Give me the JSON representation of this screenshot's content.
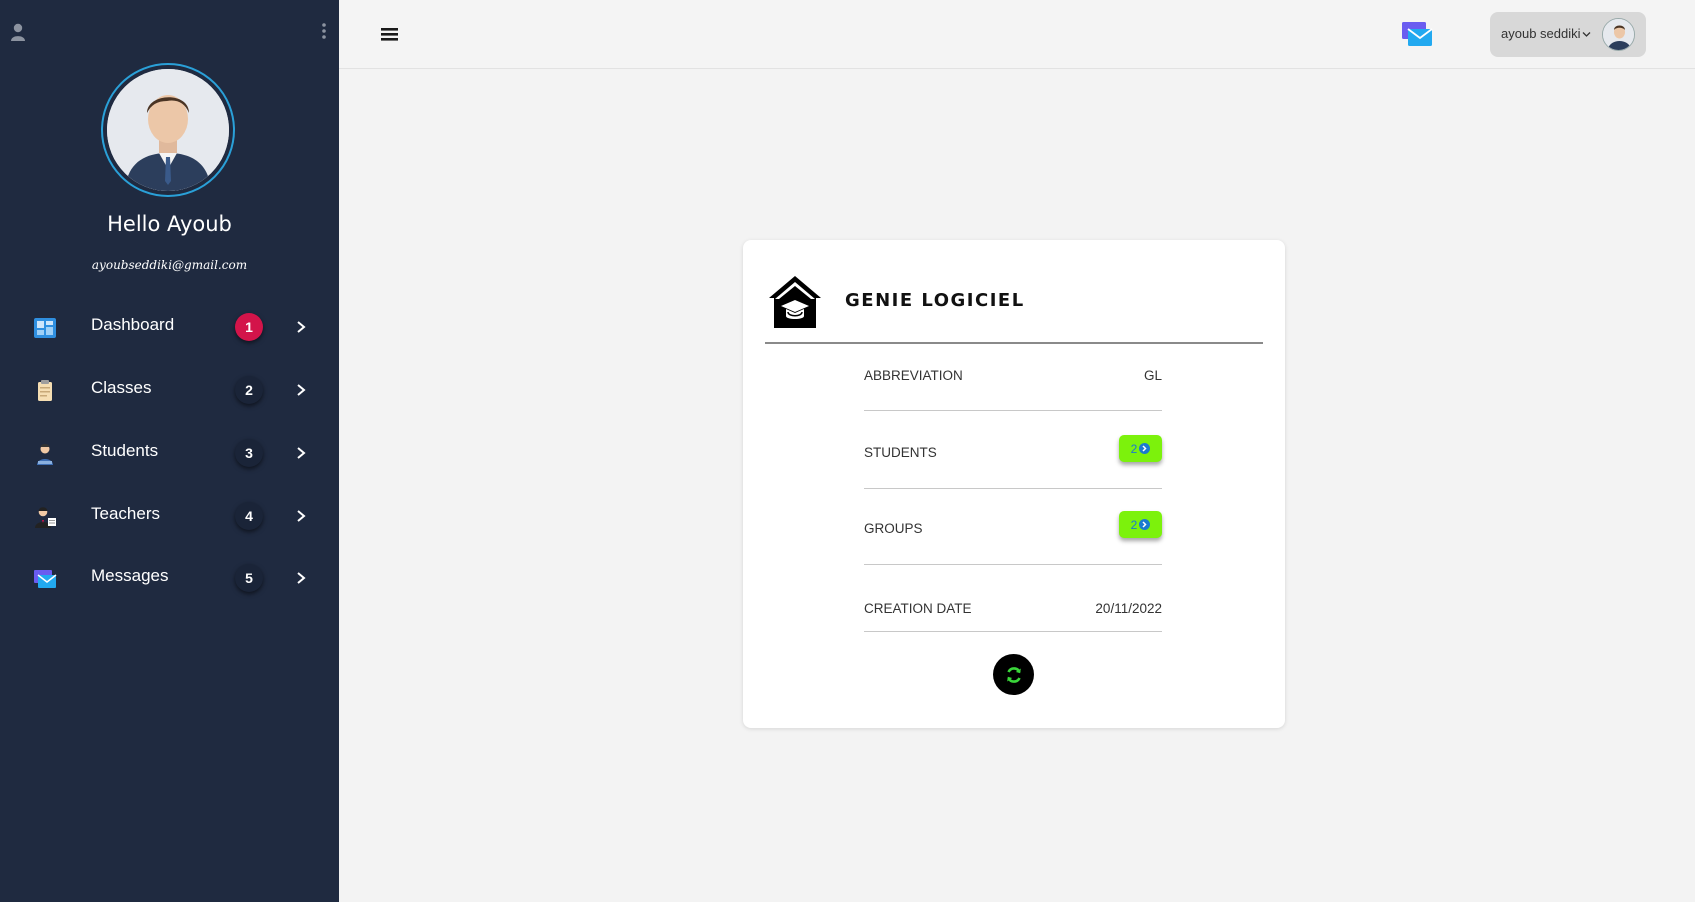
{
  "sidebar": {
    "greeting": "Hello Ayoub",
    "email": "ayoubseddiki@gmail.com",
    "items": [
      {
        "label": "Dashboard",
        "badge": "1"
      },
      {
        "label": "Classes",
        "badge": "2"
      },
      {
        "label": "Students",
        "badge": "3"
      },
      {
        "label": "Teachers",
        "badge": "4"
      },
      {
        "label": "Messages",
        "badge": "5"
      }
    ]
  },
  "topbar": {
    "user_name": "ayoub seddiki"
  },
  "card": {
    "title": "GENIE LOGICIEL",
    "rows": [
      {
        "label": "ABBREVIATION",
        "value": "GL"
      },
      {
        "label": "STUDENTS",
        "value": "2"
      },
      {
        "label": "GROUPS",
        "value": "2"
      },
      {
        "label": "CREATION DATE",
        "value": "20/11/2022"
      }
    ]
  },
  "colors": {
    "sidebar_bg": "#1f2a40",
    "active_badge": "#d3144a",
    "pill_green": "#7cf20c",
    "page_bg": "#f3f3f3"
  },
  "icons": {
    "sidebar_user": "user-icon",
    "sidebar_menu": "kebab-menu-icon",
    "nav": [
      "dashboard-icon",
      "clipboard-icon",
      "student-icon",
      "teacher-icon",
      "envelope-icon"
    ],
    "topbar_menu": "hamburger-icon",
    "topbar_mail": "envelope-icon",
    "card": "graduation-house-icon",
    "refresh": "refresh-icon"
  }
}
